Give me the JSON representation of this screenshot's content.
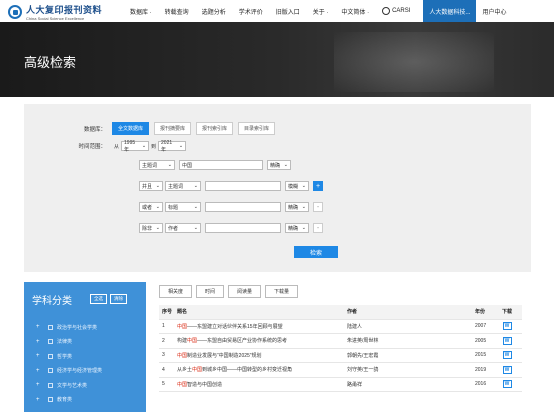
{
  "logo": {
    "cn": "人大复印报刊资料",
    "en": "China Social Science Excellence"
  },
  "nav": [
    {
      "label": "数据库 ·",
      "active": false
    },
    {
      "label": "转载查询",
      "active": false
    },
    {
      "label": "选题分析",
      "active": false
    },
    {
      "label": "学术评价",
      "active": false
    },
    {
      "label": "旧版入口",
      "active": false
    },
    {
      "label": "关于 ·",
      "active": false
    },
    {
      "label": "中文简体 ·",
      "active": false
    },
    {
      "label": "CARSI",
      "active": false
    },
    {
      "label": "人大数据科技...",
      "active": true
    },
    {
      "label": "用户中心",
      "active": false
    }
  ],
  "banner": {
    "title": "高级检索"
  },
  "search": {
    "db_label": "数据库：",
    "db_tabs": [
      "全文数据库",
      "报刊摘要库",
      "报刊索引库",
      "目录索引库"
    ],
    "time_label": "时间范围：",
    "from": "从",
    "from_year": "1995年",
    "to": "到",
    "to_year": "2021年",
    "rows": [
      {
        "logic": "",
        "field": "主题词",
        "value": "中国",
        "match": "精确"
      },
      {
        "logic": "并且",
        "field": "主题词",
        "value": "",
        "match": "模糊"
      },
      {
        "logic": "或者",
        "field": "标题",
        "value": "",
        "match": "精确"
      },
      {
        "logic": "除非",
        "field": "作者",
        "value": "",
        "match": "精确"
      }
    ],
    "button": "检索"
  },
  "sidebar": {
    "title": "学科分类",
    "select_all": "全选",
    "clear": "清除",
    "items": [
      "政治学与社会学类",
      "法律类",
      "哲学类",
      "经济学与经济管理类",
      "文学与艺术类",
      "教育类"
    ]
  },
  "results": {
    "tabs": [
      "相关度",
      "时间",
      "阅读量",
      "下载量"
    ],
    "headers": {
      "no": "序号",
      "title": "题名",
      "author": "作者",
      "year": "年份",
      "dl": "下载"
    },
    "rows": [
      {
        "no": "1",
        "pre": "",
        "hl": "中国",
        "post": "——东盟建立对话伙伴关系15年回顾与展望",
        "author": "陆建人",
        "year": "2007"
      },
      {
        "no": "2",
        "pre": "构建",
        "hl": "中国",
        "post": "——东盟自由贸易区产业协作系统的思考",
        "author": "朱进英/周世林",
        "year": "2005"
      },
      {
        "no": "3",
        "pre": "",
        "hl": "中国",
        "post": "制造业发展与“中国制造2025”规划",
        "author": "郭朝先/王宏霞",
        "year": "2015"
      },
      {
        "no": "4",
        "pre": "从乡土",
        "hl": "中国",
        "post": "到城乡中国——中国转型的乡村变迁视角",
        "author": "刘守英/王一鸽",
        "year": "2019"
      },
      {
        "no": "5",
        "pre": "",
        "hl": "中国",
        "post": "智造与中国创造",
        "author": "路甬祥",
        "year": "2016"
      }
    ]
  }
}
